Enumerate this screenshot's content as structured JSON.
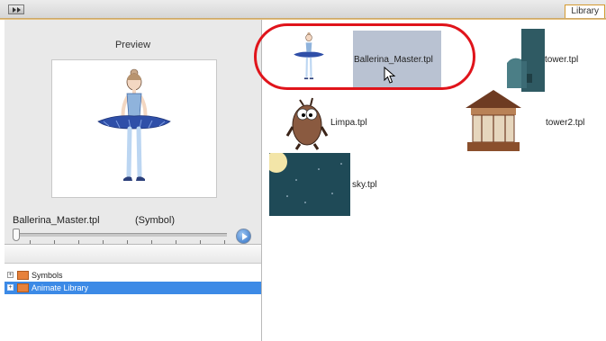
{
  "topbar": {
    "tab_label": "Library"
  },
  "preview": {
    "title": "Preview",
    "selected_name": "Ballerina_Master.tpl",
    "selected_type": "(Symbol)",
    "slider_position": 0.0
  },
  "tree": {
    "items": [
      {
        "label": "Symbols",
        "expander": "+",
        "selected": false
      },
      {
        "label": "Animate Library",
        "expander": "+",
        "selected": true
      }
    ]
  },
  "library": {
    "items": [
      {
        "label": "Ballerina_Master.tpl",
        "selected": true
      },
      {
        "label": "tower.tpl",
        "selected": false
      },
      {
        "label": "Limpa.tpl",
        "selected": false
      },
      {
        "label": "tower2.tpl",
        "selected": false
      },
      {
        "label": "sky.tpl",
        "selected": false
      }
    ]
  },
  "colors": {
    "selection": "#b9c2d2",
    "tree_selection": "#3c8ae6",
    "annotation_ring": "#e0141b",
    "tab_accent": "#d59a2f"
  }
}
